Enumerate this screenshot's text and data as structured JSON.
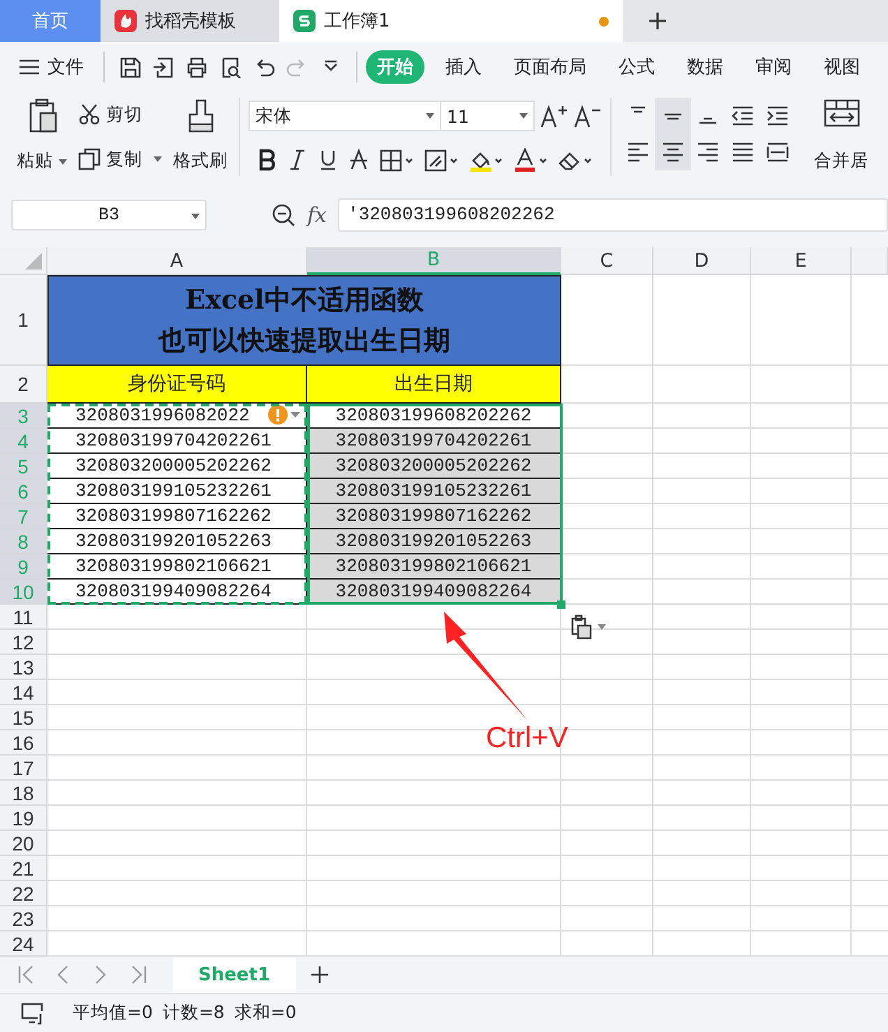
{
  "tabs": [
    {
      "label": "首页",
      "kind": "home",
      "selected": false,
      "unsaved": false
    },
    {
      "label": "找稻壳模板",
      "kind": "docer",
      "selected": false,
      "unsaved": false
    },
    {
      "label": "工作簿1",
      "kind": "sheet",
      "selected": true,
      "unsaved": true
    }
  ],
  "menu": {
    "file": "文件",
    "tabs": [
      {
        "label": "开始",
        "selected": true
      },
      {
        "label": "插入",
        "selected": false
      },
      {
        "label": "页面布局",
        "selected": false
      },
      {
        "label": "公式",
        "selected": false
      },
      {
        "label": "数据",
        "selected": false
      },
      {
        "label": "审阅",
        "selected": false
      },
      {
        "label": "视图",
        "selected": false
      }
    ]
  },
  "ribbon": {
    "paste": "粘贴",
    "cut": "剪切",
    "copy": "复制",
    "format_painter": "格式刷",
    "font": "宋体",
    "size": "11",
    "merge": "合并居",
    "align_buttons": [
      {
        "selected": false
      },
      {
        "selected": true
      },
      {
        "selected": false
      },
      {
        "selected": false
      },
      {
        "selected": false
      },
      {
        "selected": false
      },
      {
        "selected": true
      },
      {
        "selected": false
      },
      {
        "selected": false
      },
      {
        "selected": false
      }
    ]
  },
  "formula_bar": {
    "cell": "B3",
    "fx": "fx",
    "value": "'320803199608202262"
  },
  "sheet": {
    "columns": [
      {
        "label": "A",
        "selected": false
      },
      {
        "label": "B",
        "selected": true
      },
      {
        "label": "C",
        "selected": false
      },
      {
        "label": "D",
        "selected": false
      },
      {
        "label": "E",
        "selected": false
      }
    ],
    "row_headers": [
      {
        "label": "1",
        "selected": false
      },
      {
        "label": "2",
        "selected": false
      },
      {
        "label": "3",
        "selected": true
      },
      {
        "label": "4",
        "selected": true
      },
      {
        "label": "5",
        "selected": true
      },
      {
        "label": "6",
        "selected": true
      },
      {
        "label": "7",
        "selected": true
      },
      {
        "label": "8",
        "selected": true
      },
      {
        "label": "9",
        "selected": true
      },
      {
        "label": "10",
        "selected": true
      },
      {
        "label": "11",
        "selected": false
      },
      {
        "label": "12",
        "selected": false
      },
      {
        "label": "13",
        "selected": false
      },
      {
        "label": "14",
        "selected": false
      },
      {
        "label": "15",
        "selected": false
      },
      {
        "label": "16",
        "selected": false
      },
      {
        "label": "17",
        "selected": false
      },
      {
        "label": "18",
        "selected": false
      },
      {
        "label": "19",
        "selected": false
      },
      {
        "label": "20",
        "selected": false
      },
      {
        "label": "21",
        "selected": false
      },
      {
        "label": "22",
        "selected": false
      },
      {
        "label": "23",
        "selected": false
      },
      {
        "label": "24",
        "selected": false
      }
    ],
    "title_lines": [
      "Excel中不适用函数",
      "也可以快速提取出生日期"
    ],
    "headers": [
      "身份证号码",
      "出生日期"
    ],
    "rows": [
      {
        "id": "3208031996082022",
        "birth": "320803199608202262",
        "active": true,
        "warning": true
      },
      {
        "id": "320803199704202261",
        "birth": "320803199704202261",
        "active": false,
        "warning": false
      },
      {
        "id": "320803200005202262",
        "birth": "320803200005202262",
        "active": false,
        "warning": false
      },
      {
        "id": "320803199105232261",
        "birth": "320803199105232261",
        "active": false,
        "warning": false
      },
      {
        "id": "320803199807162262",
        "birth": "320803199807162262",
        "active": false,
        "warning": false
      },
      {
        "id": "320803199201052263",
        "birth": "320803199201052263",
        "active": false,
        "warning": false
      },
      {
        "id": "320803199802106621",
        "birth": "320803199802106621",
        "active": false,
        "warning": false
      },
      {
        "id": "320803199409082264",
        "birth": "320803199409082264",
        "active": false,
        "warning": false
      }
    ]
  },
  "annotation": {
    "text": "Ctrl+V"
  },
  "sheet_tabs": [
    {
      "label": "Sheet1",
      "selected": true
    }
  ],
  "status": [
    "平均值=0",
    "计数=8",
    "求和=0"
  ]
}
